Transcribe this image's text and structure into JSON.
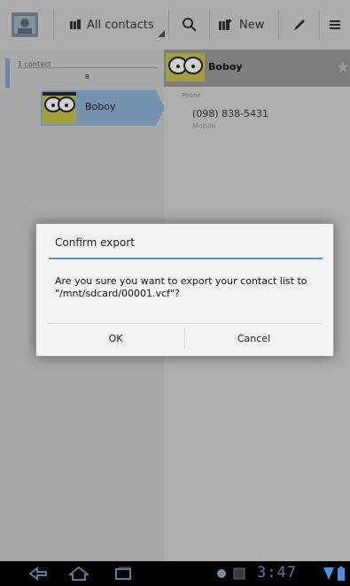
{
  "actionbar": {
    "contacts_filter": "All contacts",
    "new_label": "New"
  },
  "list": {
    "count_label": "1 contact",
    "section_letter": "B",
    "items": [
      {
        "name": "Boboy"
      }
    ]
  },
  "detail": {
    "name": "Boboy",
    "phone_header": "Phone",
    "phone_number": "(098) 838-5431",
    "phone_type": "Mobile"
  },
  "dialog": {
    "title": "Confirm export",
    "message": "Are you sure you want to export your contact list to \"/mnt/sdcard/00001.vcf\"?",
    "ok_label": "OK",
    "cancel_label": "Cancel"
  },
  "statusbar": {
    "time": "3:47"
  }
}
